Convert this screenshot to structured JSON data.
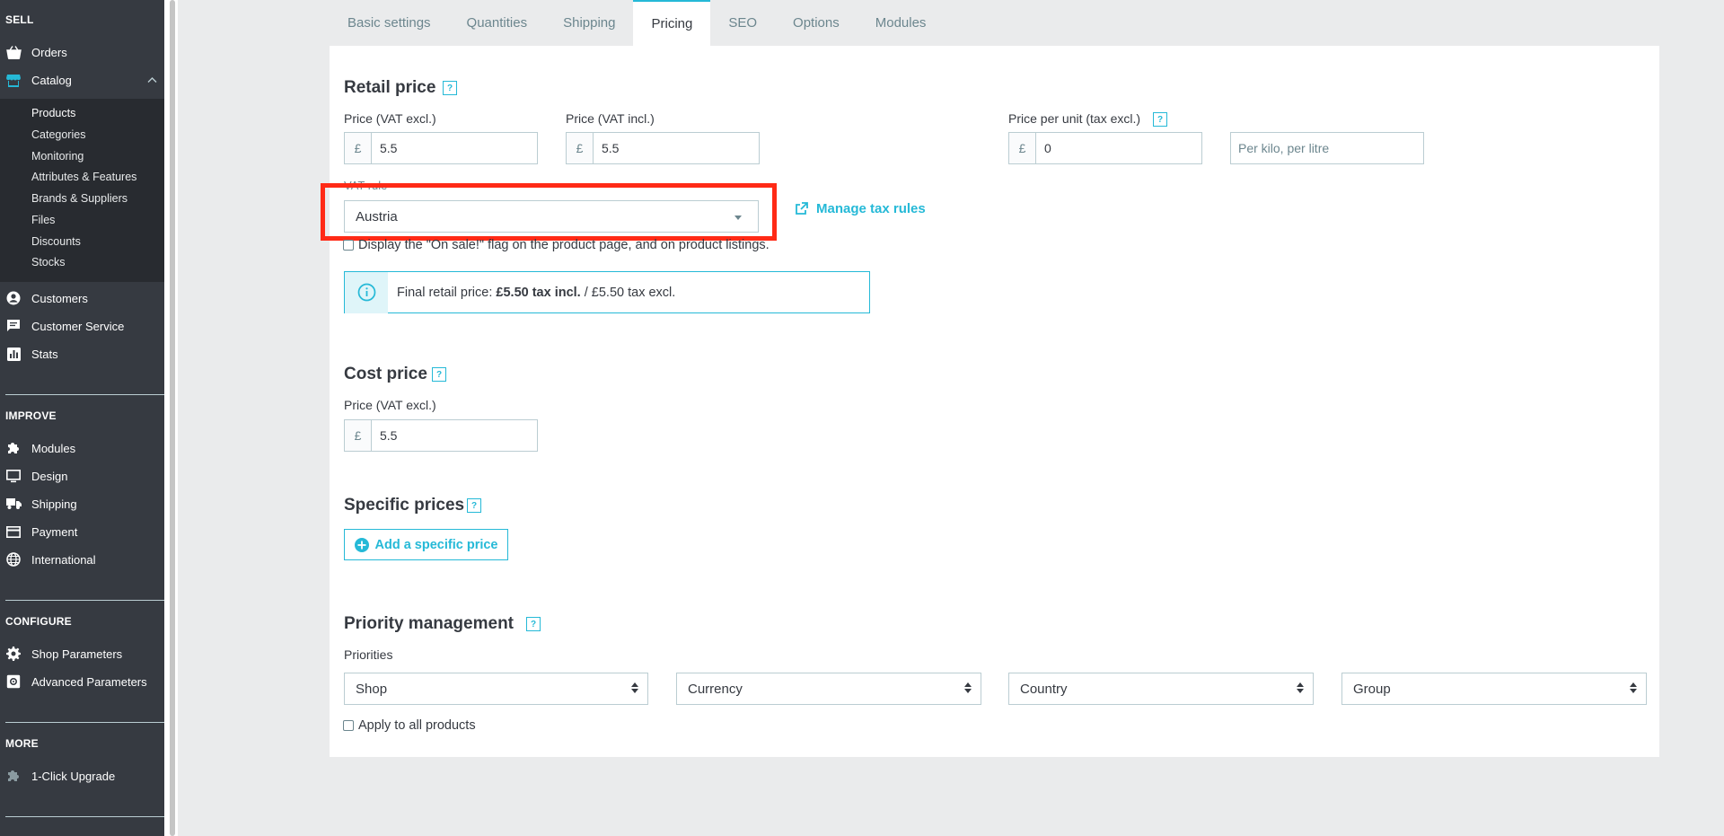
{
  "sidebar": {
    "sections": {
      "sell": "SELL",
      "improve": "IMPROVE",
      "configure": "CONFIGURE",
      "more": "MORE"
    },
    "items": {
      "orders": "Orders",
      "catalog": "Catalog",
      "customers": "Customers",
      "customer_service": "Customer Service",
      "stats": "Stats",
      "modules": "Modules",
      "design": "Design",
      "shipping": "Shipping",
      "payment": "Payment",
      "international": "International",
      "shop_parameters": "Shop Parameters",
      "advanced_parameters": "Advanced Parameters",
      "one_click_upgrade": "1-Click Upgrade"
    },
    "catalog_sub": [
      "Products",
      "Categories",
      "Monitoring",
      "Attributes & Features",
      "Brands & Suppliers",
      "Files",
      "Discounts",
      "Stocks"
    ]
  },
  "tabs": [
    "Basic settings",
    "Quantities",
    "Shipping",
    "Pricing",
    "SEO",
    "Options",
    "Modules"
  ],
  "active_tab": "Pricing",
  "retail": {
    "title": "Retail price",
    "help": "?",
    "price_excl_label": "Price (VAT excl.)",
    "price_excl_value": "5.5",
    "price_incl_label": "Price (VAT incl.)",
    "price_incl_value": "5.5",
    "currency": "£",
    "unit_label": "Price per unit (tax excl.)",
    "unit_value": "0",
    "unit_placeholder": "Per kilo, per litre",
    "vat_rule_label": "VAT rule",
    "vat_rule_value": "Austria",
    "manage_tax_rules": "Manage tax rules",
    "on_sale_label": "Display the \"On sale!\" flag on the product page, and on product listings.",
    "final_prefix": "Final retail price: ",
    "final_incl": "£5.50 tax incl.",
    "final_suffix": " / £5.50 tax excl."
  },
  "cost": {
    "title": "Cost price",
    "help": "?",
    "price_label": "Price (VAT excl.)",
    "price_value": "5.5",
    "currency": "£"
  },
  "specific": {
    "title": "Specific prices",
    "help": "?",
    "add_button": "Add a specific price"
  },
  "priority": {
    "title": "Priority management",
    "help": "?",
    "label": "Priorities",
    "selects": [
      "Shop",
      "Currency",
      "Country",
      "Group"
    ],
    "apply_all": "Apply to all products"
  },
  "colors": {
    "accent": "#25b9d7",
    "sidebar": "#363a41",
    "highlight": "#ff2a16"
  }
}
